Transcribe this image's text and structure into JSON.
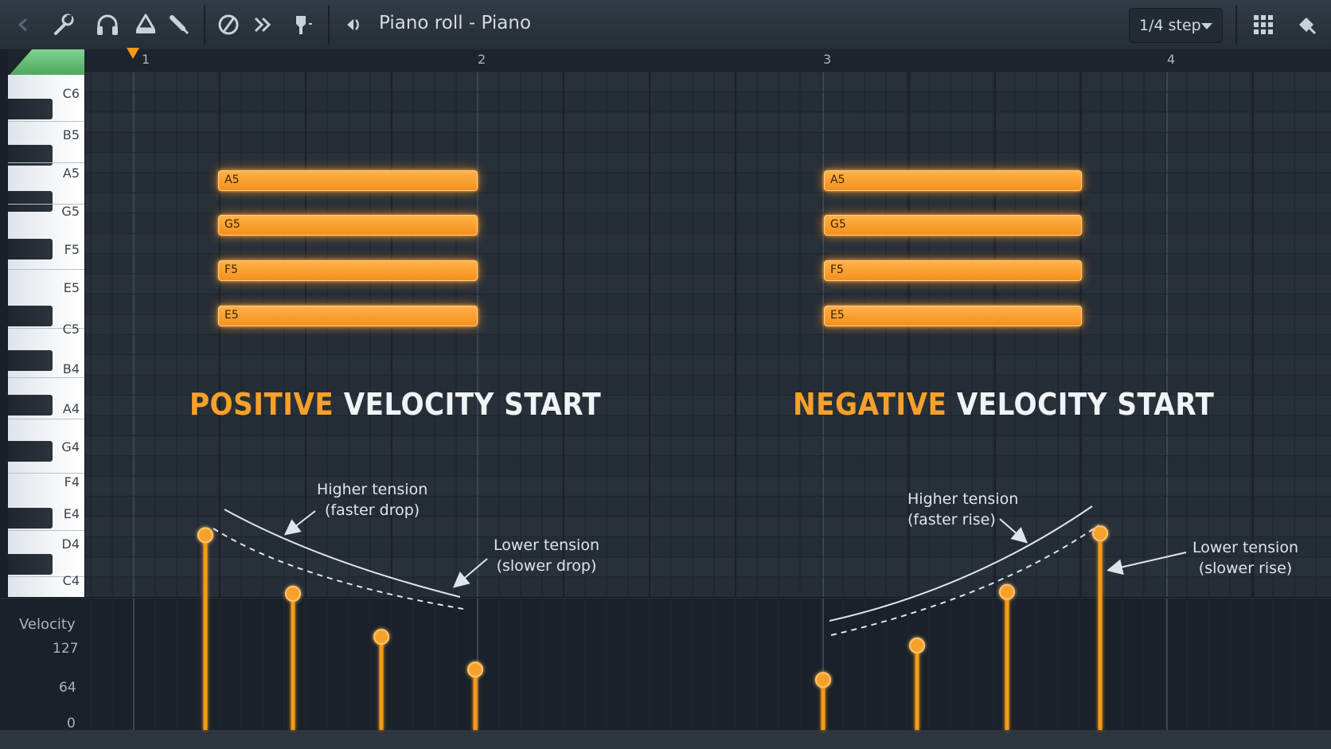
{
  "toolbar": {
    "title": "Piano roll - Piano",
    "snap": "1/4 step",
    "icons": [
      "arrow-left-icon",
      "wrench-icon",
      "headphones-icon",
      "stamp-icon",
      "brush-icon",
      "no-icon",
      "fast-forward-icon",
      "pin-icon",
      "speaker-icon",
      "grid-icon",
      "magnet-icon"
    ]
  },
  "timeline": {
    "bars": [
      "1",
      "2",
      "3",
      "4"
    ]
  },
  "keyboard": {
    "labels": [
      "C6",
      "B5",
      "A5",
      "G5",
      "F5",
      "E5",
      "C5",
      "B4",
      "A4",
      "G4",
      "F4",
      "E4",
      "D4",
      "C4"
    ]
  },
  "left_group": {
    "heading_highlight": "POSITIVE",
    "heading_rest": "VELOCITY START",
    "notes": [
      "A5",
      "G5",
      "F5",
      "E5"
    ],
    "anno_high_1": "Higher tension",
    "anno_high_2": "(faster drop)",
    "anno_low_1": "Lower tension",
    "anno_low_2": "(slower drop)",
    "velocities": [
      113,
      79,
      54,
      35
    ]
  },
  "right_group": {
    "heading_highlight": "NEGATIVE",
    "heading_rest": "VELOCITY START",
    "notes": [
      "A5",
      "G5",
      "F5",
      "E5"
    ],
    "anno_high_1": "Higher tension",
    "anno_high_2": "(faster rise)",
    "anno_low_1": "Lower tension",
    "anno_low_2": "(slower rise)",
    "velocities": [
      29,
      49,
      80,
      114
    ]
  },
  "velocity_panel": {
    "label": "Velocity",
    "ticks": [
      "127",
      "64",
      "0"
    ]
  },
  "colors": {
    "accent": "#f7a12a",
    "background": "#1e252d",
    "note": "#f5901b"
  }
}
